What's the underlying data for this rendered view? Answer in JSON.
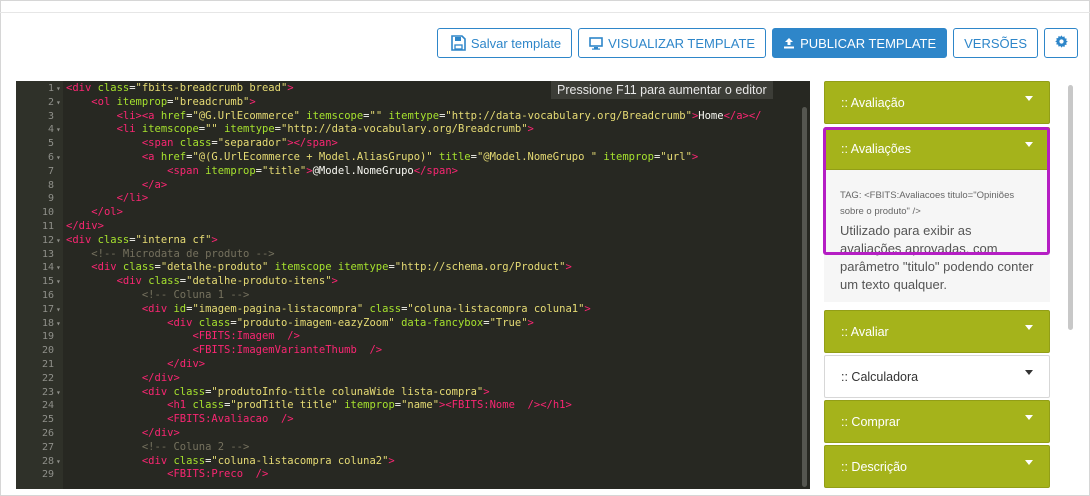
{
  "toolbar": {
    "save": "Salvar template",
    "visualize": "VISUALIZAR TEMPLATE",
    "publish": "PUBLICAR TEMPLATE",
    "versions": "VERSÕES",
    "accent": "#2e86c9"
  },
  "editor": {
    "hint": "Pressione F11 para aumentar o editor",
    "lines": [
      [
        [
          "tag",
          "<div "
        ],
        [
          "attr",
          "class"
        ],
        [
          "txt",
          "="
        ],
        [
          "str",
          "\"fbits-breadcrumb bread\""
        ],
        [
          "tag",
          ">"
        ]
      ],
      [
        [
          "txt",
          "    "
        ],
        [
          "tag",
          "<ol "
        ],
        [
          "attr",
          "itemprop"
        ],
        [
          "txt",
          "="
        ],
        [
          "str",
          "\"breadcrumb\""
        ],
        [
          "tag",
          ">"
        ]
      ],
      [
        [
          "txt",
          "        "
        ],
        [
          "tag",
          "<li><a "
        ],
        [
          "attr",
          "href"
        ],
        [
          "txt",
          "="
        ],
        [
          "str",
          "\"@G.UrlEcommerce\""
        ],
        [
          "txt",
          " "
        ],
        [
          "attr",
          "itemscope"
        ],
        [
          "txt",
          "="
        ],
        [
          "str",
          "\"\""
        ],
        [
          "txt",
          " "
        ],
        [
          "attr",
          "itemtype"
        ],
        [
          "txt",
          "="
        ],
        [
          "str",
          "\"http://data-vocabulary.org/Breadcrumb\""
        ],
        [
          "tag",
          ">"
        ],
        [
          "txt",
          "Home"
        ],
        [
          "tag",
          "</a></"
        ]
      ],
      [
        [
          "txt",
          "        "
        ],
        [
          "tag",
          "<li "
        ],
        [
          "attr",
          "itemscope"
        ],
        [
          "txt",
          "="
        ],
        [
          "str",
          "\"\""
        ],
        [
          "txt",
          " "
        ],
        [
          "attr",
          "itemtype"
        ],
        [
          "txt",
          "="
        ],
        [
          "str",
          "\"http://data-vocabulary.org/Breadcrumb\""
        ],
        [
          "tag",
          ">"
        ]
      ],
      [
        [
          "txt",
          "            "
        ],
        [
          "tag",
          "<span "
        ],
        [
          "attr",
          "class"
        ],
        [
          "txt",
          "="
        ],
        [
          "str",
          "\"separador\""
        ],
        [
          "tag",
          "></span>"
        ]
      ],
      [
        [
          "txt",
          "            "
        ],
        [
          "tag",
          "<a "
        ],
        [
          "attr",
          "href"
        ],
        [
          "txt",
          "="
        ],
        [
          "str",
          "\"@(G.UrlEcommerce + Model.AliasGrupo)\""
        ],
        [
          "txt",
          " "
        ],
        [
          "attr",
          "title"
        ],
        [
          "txt",
          "="
        ],
        [
          "str",
          "\"@Model.NomeGrupo \""
        ],
        [
          "txt",
          " "
        ],
        [
          "attr",
          "itemprop"
        ],
        [
          "txt",
          "="
        ],
        [
          "str",
          "\"url\""
        ],
        [
          "tag",
          ">"
        ]
      ],
      [
        [
          "txt",
          "                "
        ],
        [
          "tag",
          "<span "
        ],
        [
          "attr",
          "itemprop"
        ],
        [
          "txt",
          "="
        ],
        [
          "str",
          "\"title\""
        ],
        [
          "tag",
          ">"
        ],
        [
          "txt",
          "@Model.NomeGrupo"
        ],
        [
          "tag",
          "</span>"
        ]
      ],
      [
        [
          "txt",
          "            "
        ],
        [
          "tag",
          "</a>"
        ]
      ],
      [
        [
          "txt",
          "        "
        ],
        [
          "tag",
          "</li>"
        ]
      ],
      [
        [
          "txt",
          "    "
        ],
        [
          "tag",
          "</ol>"
        ]
      ],
      [
        [
          "tag",
          "</div>"
        ]
      ],
      [
        [
          "tag",
          "<div "
        ],
        [
          "attr",
          "class"
        ],
        [
          "txt",
          "="
        ],
        [
          "str",
          "\"interna cf\""
        ],
        [
          "tag",
          ">"
        ]
      ],
      [
        [
          "txt",
          "    "
        ],
        [
          "cmt",
          "<!-- Microdata de produto -->"
        ]
      ],
      [
        [
          "txt",
          "    "
        ],
        [
          "tag",
          "<div "
        ],
        [
          "attr",
          "class"
        ],
        [
          "txt",
          "="
        ],
        [
          "str",
          "\"detalhe-produto\""
        ],
        [
          "txt",
          " "
        ],
        [
          "attr",
          "itemscope"
        ],
        [
          "txt",
          " "
        ],
        [
          "attr",
          "itemtype"
        ],
        [
          "txt",
          "="
        ],
        [
          "str",
          "\"http://schema.org/Product\""
        ],
        [
          "tag",
          ">"
        ]
      ],
      [
        [
          "txt",
          "        "
        ],
        [
          "tag",
          "<div "
        ],
        [
          "attr",
          "class"
        ],
        [
          "txt",
          "="
        ],
        [
          "str",
          "\"detalhe-produto-itens\""
        ],
        [
          "tag",
          ">"
        ]
      ],
      [
        [
          "txt",
          "            "
        ],
        [
          "cmt",
          "<!-- Coluna 1 -->"
        ]
      ],
      [
        [
          "txt",
          "            "
        ],
        [
          "tag",
          "<div "
        ],
        [
          "attr",
          "id"
        ],
        [
          "txt",
          "="
        ],
        [
          "str",
          "\"imagem-pagina-listacompra\""
        ],
        [
          "txt",
          " "
        ],
        [
          "attr",
          "class"
        ],
        [
          "txt",
          "="
        ],
        [
          "str",
          "\"coluna-listacompra coluna1\""
        ],
        [
          "tag",
          ">"
        ]
      ],
      [
        [
          "txt",
          "                "
        ],
        [
          "tag",
          "<div "
        ],
        [
          "attr",
          "class"
        ],
        [
          "txt",
          "="
        ],
        [
          "str",
          "\"produto-imagem-eazyZoom\""
        ],
        [
          "txt",
          " "
        ],
        [
          "attr",
          "data-fancybox"
        ],
        [
          "txt",
          "="
        ],
        [
          "str",
          "\"True\""
        ],
        [
          "tag",
          ">"
        ]
      ],
      [
        [
          "txt",
          "                    "
        ],
        [
          "tag",
          "<FBITS:Imagem "
        ],
        [
          "txt",
          " "
        ],
        [
          "tag",
          "/>"
        ]
      ],
      [
        [
          "txt",
          "                    "
        ],
        [
          "tag",
          "<FBITS:ImagemVarianteThumb "
        ],
        [
          "txt",
          " "
        ],
        [
          "tag",
          "/>"
        ]
      ],
      [
        [
          "txt",
          "                "
        ],
        [
          "tag",
          "</div>"
        ]
      ],
      [
        [
          "txt",
          "            "
        ],
        [
          "tag",
          "</div>"
        ]
      ],
      [
        [
          "txt",
          "            "
        ],
        [
          "tag",
          "<div "
        ],
        [
          "attr",
          "class"
        ],
        [
          "txt",
          "="
        ],
        [
          "str",
          "\"produtoInfo-title colunaWide lista-compra\""
        ],
        [
          "tag",
          ">"
        ]
      ],
      [
        [
          "txt",
          "                "
        ],
        [
          "tag",
          "<h1 "
        ],
        [
          "attr",
          "class"
        ],
        [
          "txt",
          "="
        ],
        [
          "str",
          "\"prodTitle title\""
        ],
        [
          "txt",
          " "
        ],
        [
          "attr",
          "itemprop"
        ],
        [
          "txt",
          "="
        ],
        [
          "str",
          "\"name\""
        ],
        [
          "tag",
          "><FBITS:Nome "
        ],
        [
          "txt",
          " "
        ],
        [
          "tag",
          "/></h1>"
        ]
      ],
      [
        [
          "txt",
          "                "
        ],
        [
          "tag",
          "<FBITS:Avaliacao "
        ],
        [
          "txt",
          " "
        ],
        [
          "tag",
          "/>"
        ]
      ],
      [
        [
          "txt",
          "            "
        ],
        [
          "tag",
          "</div>"
        ]
      ],
      [
        [
          "txt",
          "            "
        ],
        [
          "cmt",
          "<!-- Coluna 2 -->"
        ]
      ],
      [
        [
          "txt",
          "            "
        ],
        [
          "tag",
          "<div "
        ],
        [
          "attr",
          "class"
        ],
        [
          "txt",
          "="
        ],
        [
          "str",
          "\"coluna-listacompra coluna2\""
        ],
        [
          "tag",
          ">"
        ]
      ],
      [
        [
          "txt",
          "                "
        ],
        [
          "tag",
          "<FBITS:Preco "
        ],
        [
          "txt",
          " "
        ],
        [
          "tag",
          "/>"
        ]
      ]
    ],
    "line_numbers": [
      "1",
      "2",
      "3",
      "4",
      "5",
      "6",
      "7",
      "8",
      "9",
      "10",
      "11",
      "12",
      "13",
      "14",
      "15",
      "16",
      "17",
      "18",
      "19",
      "20",
      "21",
      "22",
      "23",
      "24",
      "25",
      "26",
      "27",
      "28",
      "29"
    ],
    "folds": [
      1,
      2,
      4,
      6,
      12,
      14,
      15,
      17,
      18,
      23,
      28
    ]
  },
  "sidebar": {
    "panels": [
      {
        "label": ":: Avaliação",
        "style": "green"
      },
      {
        "label": ":: Avaliações",
        "style": "green"
      },
      {
        "label": ":: Avaliar",
        "style": "green"
      },
      {
        "label": ":: Calculadora",
        "style": "light"
      },
      {
        "label": ":: Comprar",
        "style": "green"
      },
      {
        "label": ":: Descrição",
        "style": "green"
      }
    ],
    "avaliacoes_tag": "TAG: <FBITS:Avaliacoes titulo=\"Opiniões sobre o produto\" />",
    "avaliacoes_desc": "Utilizado para exibir as avaliações aprovadas, com parâmetro \"titulo\" podendo conter um texto qualquer.",
    "panel_color": "#a5b31b",
    "highlight_color": "#b51ec4"
  }
}
